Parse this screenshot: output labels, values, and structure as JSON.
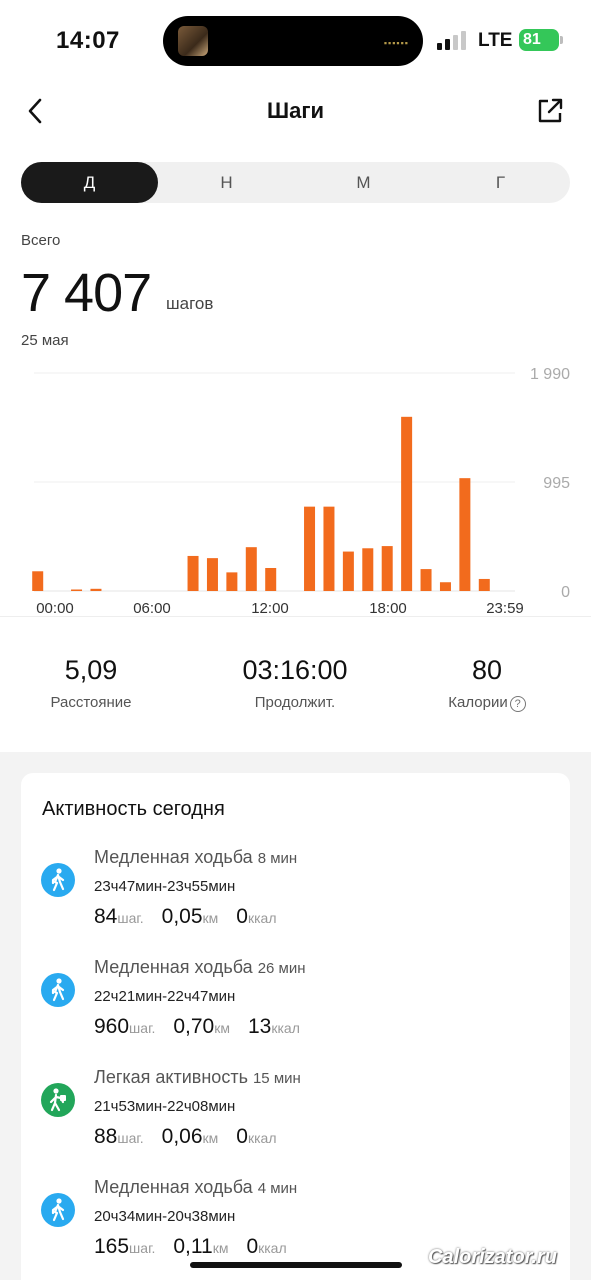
{
  "status_bar": {
    "time": "14:07",
    "network": "LTE",
    "battery": "81"
  },
  "header": {
    "title": "Шаги"
  },
  "tabs": [
    {
      "label": "Д",
      "active": true
    },
    {
      "label": "Н",
      "active": false
    },
    {
      "label": "М",
      "active": false
    },
    {
      "label": "Г",
      "active": false
    }
  ],
  "summary": {
    "label": "Всего",
    "value": "7 407",
    "unit": "шагов",
    "date": "25 мая"
  },
  "chart_data": {
    "type": "bar",
    "color": "#f26b1d",
    "x_ticks": [
      "00:00",
      "06:00",
      "12:00",
      "18:00",
      "23:59"
    ],
    "y_ticks": [
      "1 990",
      "995",
      "0"
    ],
    "ylim": [
      0,
      1990
    ],
    "bins": [
      "00:00",
      "01:00",
      "02:00",
      "03:00",
      "04:00",
      "05:00",
      "06:00",
      "07:00",
      "08:00",
      "09:00",
      "10:00",
      "11:00",
      "12:00",
      "13:00",
      "14:00",
      "15:00",
      "16:00",
      "17:00",
      "18:00",
      "19:00",
      "20:00",
      "21:00",
      "22:00",
      "23:00"
    ],
    "values": [
      180,
      0,
      10,
      20,
      0,
      0,
      0,
      0,
      320,
      300,
      170,
      400,
      210,
      0,
      770,
      770,
      360,
      390,
      410,
      1590,
      200,
      80,
      1030,
      110
    ]
  },
  "stats": [
    {
      "value": "5,09",
      "label": "Расстояние"
    },
    {
      "value": "03:16:00",
      "label": "Продолжит."
    },
    {
      "value": "80",
      "label": "Калории"
    }
  ],
  "activity": {
    "title": "Активность сегодня",
    "items": [
      {
        "name": "Медленная ходьба",
        "duration": "8 мин",
        "time": "23ч47мин-23ч55мин",
        "steps": "84",
        "steps_unit": "шаг.",
        "distance": "0,05",
        "distance_unit": "км",
        "calories": "0",
        "calories_unit": "ккал",
        "icon": "walking-icon",
        "color": "#29aaf0"
      },
      {
        "name": "Медленная ходьба",
        "duration": "26 мин",
        "time": "22ч21мин-22ч47мин",
        "steps": "960",
        "steps_unit": "шаг.",
        "distance": "0,70",
        "distance_unit": "км",
        "calories": "13",
        "calories_unit": "ккал",
        "icon": "walking-icon",
        "color": "#29aaf0"
      },
      {
        "name": "Легкая активность",
        "duration": "15 мин",
        "time": "21ч53мин-22ч08мин",
        "steps": "88",
        "steps_unit": "шаг.",
        "distance": "0,06",
        "distance_unit": "км",
        "calories": "0",
        "calories_unit": "ккал",
        "icon": "light-activity-icon",
        "color": "#22a65a"
      },
      {
        "name": "Медленная ходьба",
        "duration": "4 мин",
        "time": "20ч34мин-20ч38мин",
        "steps": "165",
        "steps_unit": "шаг.",
        "distance": "0,11",
        "distance_unit": "км",
        "calories": "0",
        "calories_unit": "ккал",
        "icon": "walking-icon",
        "color": "#29aaf0"
      }
    ]
  },
  "watermark": "Calorizator.ru"
}
